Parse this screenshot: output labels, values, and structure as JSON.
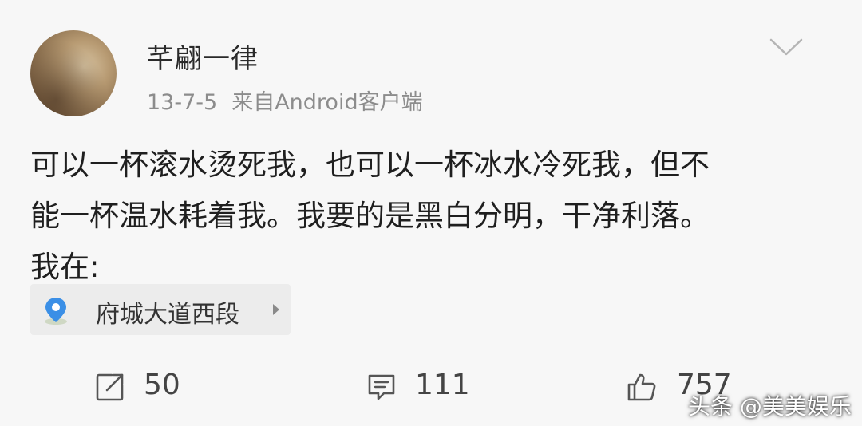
{
  "post": {
    "author": "芊翩一律",
    "date": "13-7-5",
    "source": "来自Android客户端",
    "text_lines": [
      "可以一杯滚水烫死我，也可以一杯冰水冷死我，但不",
      "能一杯温水耗着我。我要的是黑白分明，干净利落。",
      "我在:"
    ],
    "location": {
      "label": "府城大道西段",
      "icon": "location-pin-icon"
    }
  },
  "actions": {
    "repost": {
      "icon": "repost-icon",
      "count": "50"
    },
    "comment": {
      "icon": "comment-icon",
      "count": "111"
    },
    "like": {
      "icon": "thumbs-up-icon",
      "count": "757"
    }
  },
  "menu": {
    "icon": "chevron-down-icon"
  },
  "watermark": "头条 @美美娱乐",
  "colors": {
    "background": "#f7f7f7",
    "text": "#1f1f1f",
    "meta": "#8c8c8c",
    "location_bg": "#ececec",
    "pin": "#3b8fe6"
  }
}
